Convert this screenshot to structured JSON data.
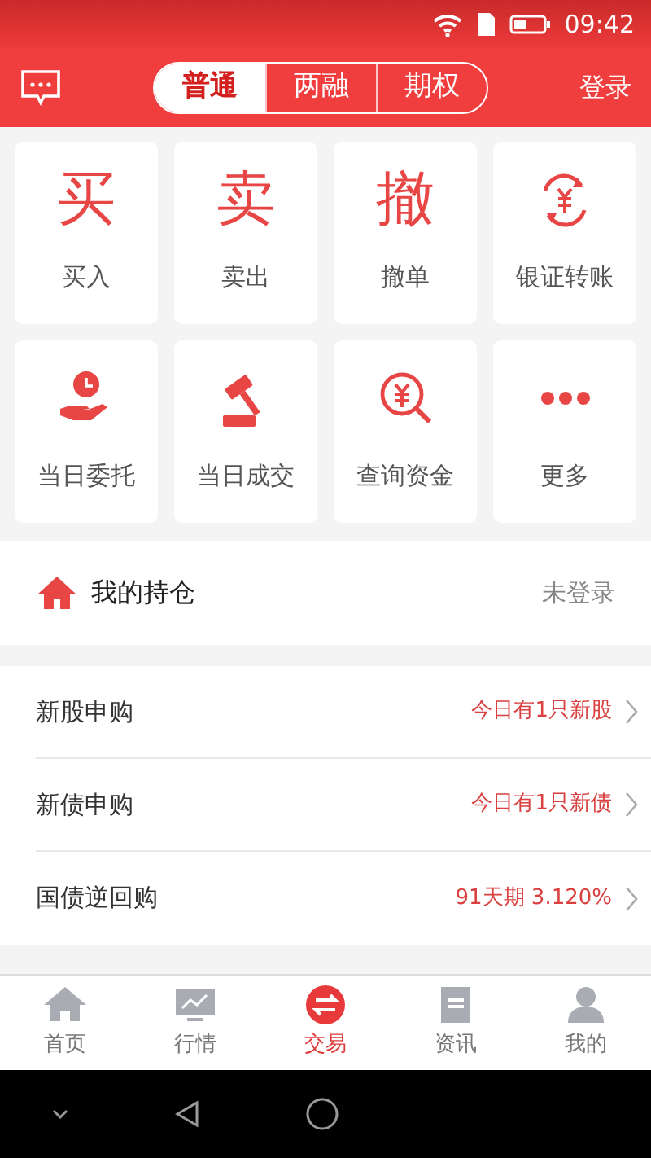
{
  "status_bar": {
    "time": "09:42"
  },
  "header": {
    "tabs": [
      {
        "label": "普通",
        "selected": true
      },
      {
        "label": "两融",
        "selected": false
      },
      {
        "label": "期权",
        "selected": false
      }
    ],
    "login": "登录"
  },
  "actions": [
    {
      "kind": "glyph",
      "glyph": "买",
      "label": "买入"
    },
    {
      "kind": "glyph",
      "glyph": "卖",
      "label": "卖出"
    },
    {
      "kind": "glyph",
      "glyph": "撤",
      "label": "撤单"
    },
    {
      "kind": "icon",
      "label": "银证转账"
    },
    {
      "kind": "icon",
      "label": "当日委托"
    },
    {
      "kind": "icon",
      "label": "当日成交"
    },
    {
      "kind": "icon",
      "label": "查询资金"
    },
    {
      "kind": "icon",
      "label": "更多"
    }
  ],
  "holdings": {
    "title": "我的持仓",
    "status": "未登录"
  },
  "services": [
    {
      "label": "新股申购",
      "info": "今日有1只新股"
    },
    {
      "label": "新债申购",
      "info": "今日有1只新债"
    },
    {
      "label": "国债逆回购",
      "info": "91天期 3.120%"
    }
  ],
  "bottom_nav": [
    {
      "label": "首页",
      "selected": false
    },
    {
      "label": "行情",
      "selected": false
    },
    {
      "label": "交易",
      "selected": true
    },
    {
      "label": "资讯",
      "selected": false
    },
    {
      "label": "我的",
      "selected": false
    }
  ]
}
